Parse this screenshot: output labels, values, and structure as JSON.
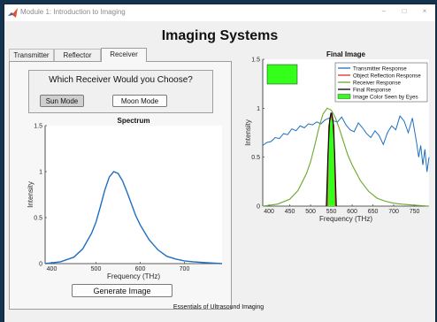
{
  "window": {
    "title": "Module 1: Introduction to Imaging",
    "minimize": "–",
    "maximize": "□",
    "close": "×"
  },
  "app_title": "Imaging Systems",
  "tabs": [
    {
      "label": "Transmitter",
      "active": false
    },
    {
      "label": "Reflector",
      "active": false
    },
    {
      "label": "Receiver",
      "active": true
    }
  ],
  "receiver": {
    "question": "Which Receiver Would you Choose?",
    "sun_mode_label": "Sun Mode",
    "moon_mode_label": "Moon Mode",
    "selected": "Sun Mode",
    "generate_label": "Generate Image"
  },
  "footer": "Essentials of Ultrasound Imaging",
  "colors": {
    "transmitter": "#1f6fc0",
    "object": "#d9302c",
    "receiver": "#6aa829",
    "final": "#000000",
    "seen": "#33ff1a",
    "spectrum": "#1f6fc0"
  },
  "chart_data": [
    {
      "type": "line",
      "title": "Spectrum",
      "xlabel": "Frequency (THz)",
      "ylabel": "Intensity",
      "xlim": [
        385,
        785
      ],
      "ylim": [
        0,
        1.5
      ],
      "xticks": [
        400,
        500,
        600,
        700
      ],
      "yticks": [
        0,
        0.5,
        1,
        1.5
      ],
      "series": [
        {
          "x": [
            385,
            420,
            450,
            470,
            490,
            500,
            510,
            520,
            530,
            540,
            550,
            560,
            570,
            580,
            590,
            600,
            620,
            640,
            660,
            680,
            700,
            720,
            750,
            785
          ],
          "y": [
            0.0,
            0.02,
            0.07,
            0.16,
            0.33,
            0.45,
            0.62,
            0.8,
            0.94,
            1.0,
            0.98,
            0.9,
            0.78,
            0.65,
            0.52,
            0.42,
            0.26,
            0.15,
            0.08,
            0.05,
            0.03,
            0.02,
            0.01,
            0.0
          ]
        }
      ]
    },
    {
      "type": "line",
      "title": "Final Image",
      "xlabel": "Frequency (THz)",
      "ylabel": "Intensity",
      "xlim": [
        385,
        785
      ],
      "ylim": [
        0,
        1.5
      ],
      "xticks": [
        400,
        450,
        500,
        550,
        600,
        650,
        700,
        750
      ],
      "yticks": [
        0,
        0.5,
        1,
        1.5
      ],
      "legend": "top-right",
      "image_color_swatch": "top-left",
      "series": [
        {
          "name": "Transmitter Response",
          "x": [
            385,
            395,
            405,
            415,
            425,
            435,
            445,
            455,
            465,
            475,
            485,
            495,
            505,
            515,
            525,
            535,
            545,
            555,
            565,
            575,
            585,
            595,
            605,
            615,
            625,
            635,
            645,
            655,
            665,
            675,
            685,
            695,
            705,
            715,
            725,
            735,
            745,
            755,
            760,
            765,
            770,
            775,
            780,
            785
          ],
          "y": [
            0.62,
            0.65,
            0.66,
            0.7,
            0.69,
            0.74,
            0.73,
            0.79,
            0.77,
            0.82,
            0.8,
            0.84,
            0.83,
            0.86,
            0.84,
            0.88,
            0.9,
            0.87,
            0.86,
            0.91,
            0.83,
            0.78,
            0.76,
            0.85,
            0.8,
            0.74,
            0.7,
            0.77,
            0.72,
            0.63,
            0.75,
            0.82,
            0.78,
            0.92,
            0.87,
            0.75,
            0.9,
            0.65,
            0.5,
            0.62,
            0.42,
            0.58,
            0.35,
            0.5
          ]
        },
        {
          "name": "Object Reflection Response",
          "x": [
            540,
            544,
            548,
            550,
            552,
            556,
            560
          ],
          "y": [
            0.0,
            0.82,
            0.9,
            0.93,
            0.9,
            0.82,
            0.0
          ]
        },
        {
          "name": "Receiver Response",
          "x": [
            385,
            420,
            450,
            470,
            490,
            500,
            510,
            520,
            530,
            540,
            550,
            560,
            570,
            580,
            590,
            600,
            620,
            640,
            660,
            680,
            700,
            720,
            750,
            785
          ],
          "y": [
            0.0,
            0.02,
            0.07,
            0.16,
            0.33,
            0.45,
            0.62,
            0.8,
            0.94,
            1.0,
            0.98,
            0.9,
            0.78,
            0.65,
            0.52,
            0.42,
            0.26,
            0.15,
            0.08,
            0.05,
            0.03,
            0.02,
            0.01,
            0.0
          ]
        },
        {
          "name": "Final Response",
          "x": [
            538,
            542,
            546,
            549,
            551,
            554,
            558,
            562
          ],
          "y": [
            0.0,
            0.55,
            0.88,
            0.95,
            0.95,
            0.88,
            0.55,
            0.0
          ]
        },
        {
          "name": "Image Color Seen by Eyes",
          "x": [
            538,
            542,
            546,
            549,
            551,
            554,
            558,
            562
          ],
          "y": [
            0.0,
            0.55,
            0.88,
            0.95,
            0.95,
            0.88,
            0.55,
            0.0
          ]
        }
      ]
    }
  ]
}
